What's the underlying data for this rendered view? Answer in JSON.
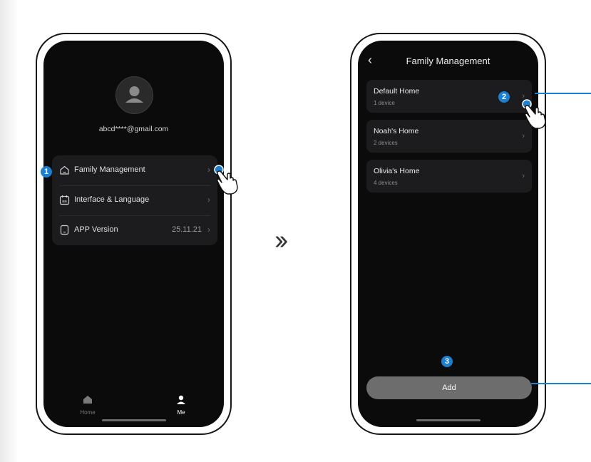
{
  "screen1": {
    "email": "abcd****@gmail.com",
    "menu": [
      {
        "label": "Family Management",
        "icon": "home-icon",
        "value": ""
      },
      {
        "label": "Interface & Language",
        "icon": "language-icon",
        "value": ""
      },
      {
        "label": "APP Version",
        "icon": "phone-icon",
        "value": "25.11.21"
      }
    ],
    "tabs": [
      {
        "label": "Home",
        "icon": "home-tab-icon"
      },
      {
        "label": "Me",
        "icon": "user-tab-icon"
      }
    ]
  },
  "screen2": {
    "title": "Family Management",
    "homes": [
      {
        "name": "Default Home",
        "devices": "1 device"
      },
      {
        "name": "Noah's Home",
        "devices": "2 devices"
      },
      {
        "name": "Olivia's Home",
        "devices": "4 devices"
      }
    ],
    "add_label": "Add"
  },
  "steps": [
    "1",
    "2",
    "3"
  ],
  "colors": {
    "accent": "#1b7fd2",
    "screen_bg": "#0b0b0b",
    "card_bg": "#1c1c1e",
    "add_button": "#6d6d6d"
  }
}
